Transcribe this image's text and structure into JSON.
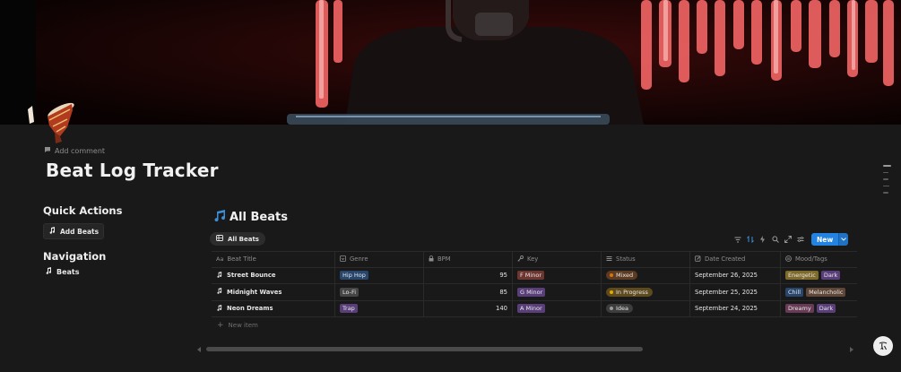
{
  "page": {
    "title": "Beat Log Tracker",
    "add_comment": "Add comment",
    "cover_icon": "person-with-headphones-red-waveform-image",
    "page_icon": "drum-icon"
  },
  "quick_actions": {
    "heading": "Quick Actions",
    "add_beats_label": "Add Beats"
  },
  "navigation": {
    "heading": "Navigation",
    "items": [
      {
        "label": "Beats",
        "icon": "music-note-icon"
      }
    ]
  },
  "database": {
    "title": "All Beats",
    "title_icon": "musical-notes-icon",
    "view_tab": "All Beats",
    "toolbar": {
      "icons": [
        "filter-icon",
        "sort-icon",
        "automation-icon",
        "search-icon",
        "expand-icon",
        "settings-icon"
      ],
      "new_label": "New"
    },
    "columns": [
      {
        "label": "Beat Title",
        "icon": "text-icon"
      },
      {
        "label": "Genre",
        "icon": "select-icon"
      },
      {
        "label": "BPM",
        "icon": "lock-icon"
      },
      {
        "label": "Key",
        "icon": "key-icon"
      },
      {
        "label": "Status",
        "icon": "status-icon"
      },
      {
        "label": "Date Created",
        "icon": "calendar-edit-icon"
      },
      {
        "label": "Mood/Tags",
        "icon": "multi-select-icon"
      }
    ],
    "rows": [
      {
        "title": "Street Bounce",
        "genre": "Hip Hop",
        "bpm": "95",
        "key": "F Minor",
        "status": "Mixed",
        "date": "September 26, 2025",
        "tags": [
          "Energetic",
          "Dark"
        ]
      },
      {
        "title": "Midnight Waves",
        "genre": "Lo-Fi",
        "bpm": "85",
        "key": "G Minor",
        "status": "In Progress",
        "date": "September 25, 2025",
        "tags": [
          "Chill",
          "Melancholic"
        ]
      },
      {
        "title": "Neon Dreams",
        "genre": "Trap",
        "bpm": "140",
        "key": "A Minor",
        "status": "Idea",
        "date": "September 24, 2025",
        "tags": [
          "Dreamy",
          "Dark"
        ]
      }
    ],
    "new_item": "New item"
  },
  "colors": {
    "background": "#191919",
    "accent": "#2383e2",
    "tag_blue": "#28456c",
    "tag_gray": "#454545",
    "tag_purple": "#5a3e7a",
    "tag_red": "#6e3630",
    "tag_pink": "#693a56",
    "tag_brown": "#5f4636",
    "tag_orange": "#854c1d",
    "tag_yellow": "#7f6a2c",
    "status_mixed_dot": "#d9730d",
    "status_progress_dot": "#dfab01",
    "status_idea_dot": "#9b9a97"
  }
}
